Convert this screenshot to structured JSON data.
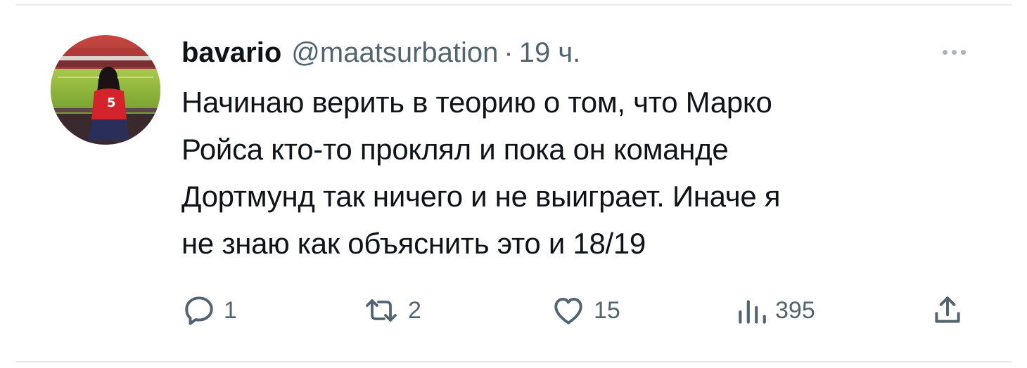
{
  "tweet": {
    "display_name": "bavario",
    "handle": "@maatsurbation",
    "separator": "·",
    "timestamp": "19 ч.",
    "text": "Начинаю верить в теорию о том, что Марко\nРойса кто-то проклял и пока он команде\nДортмунд так ничего и не выиграет. Иначе я\nне знаю как объяснить это и 18/19",
    "avatar": {
      "description_icon": "user-avatar-photo"
    }
  },
  "actions": {
    "reply": {
      "icon": "reply-icon",
      "count": "1"
    },
    "retweet": {
      "icon": "retweet-icon",
      "count": "2"
    },
    "like": {
      "icon": "heart-icon",
      "count": "15"
    },
    "views": {
      "icon": "views-chart-icon",
      "count": "395"
    },
    "share": {
      "icon": "share-icon"
    }
  },
  "colors": {
    "text_primary": "#0f1419",
    "text_secondary": "#536471",
    "divider": "#e6e8ea",
    "more_dots": "#a9b4bd"
  }
}
